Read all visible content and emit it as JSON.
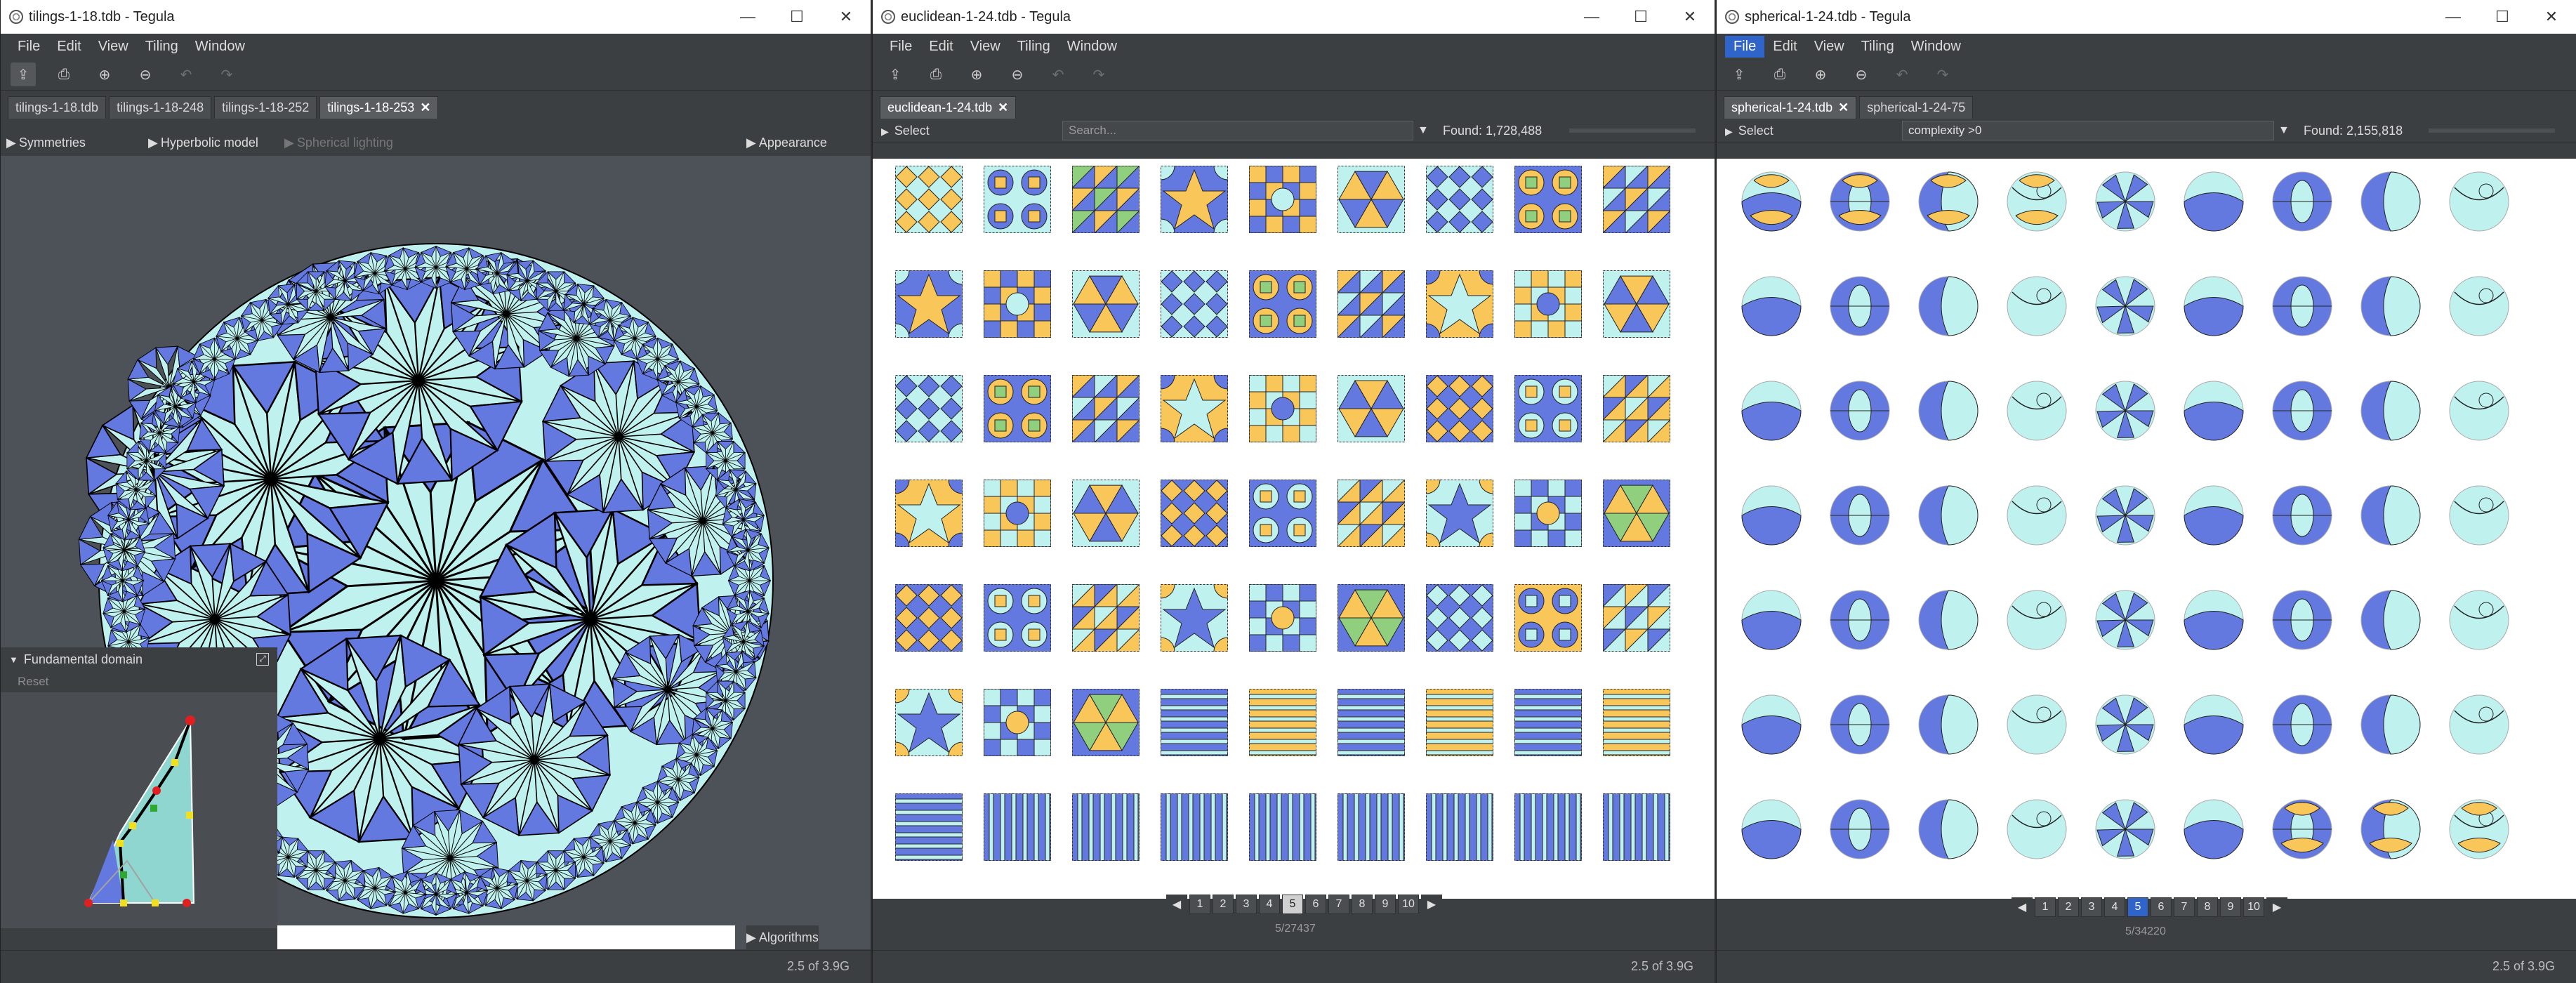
{
  "windows": [
    {
      "title": "tilings-1-18.tdb - Tegula",
      "menu": [
        "File",
        "Edit",
        "View",
        "Tiling",
        "Window"
      ],
      "tabs": [
        "tilings-1-18.tdb",
        "tilings-1-18-248",
        "tilings-1-18-252",
        "tilings-1-18-253"
      ],
      "selected_tab": 3,
      "panels": {
        "symmetries": "Symmetries",
        "hyperbolic": "Hyperbolic model",
        "spherical": "Spherical lighting",
        "appearance": "Appearance",
        "fundamental": "Fundamental domain",
        "reset": "Reset",
        "algorithms": "Algorithms"
      },
      "memory": "2.5 of 3.9G"
    },
    {
      "title": "euclidean-1-24.tdb - Tegula",
      "menu": [
        "File",
        "Edit",
        "View",
        "Tiling",
        "Window"
      ],
      "tabs": [
        "euclidean-1-24.tdb"
      ],
      "select_label": "Select",
      "search_placeholder": "Search...",
      "found": "Found: 1,728,488",
      "pages": [
        "1",
        "2",
        "3",
        "4",
        "5",
        "6",
        "7",
        "8",
        "9",
        "10"
      ],
      "current_page": 4,
      "page_count": "5/27437",
      "memory": "2.5 of 3.9G"
    },
    {
      "title": "spherical-1-24.tdb - Tegula",
      "menu": [
        "File",
        "Edit",
        "View",
        "Tiling",
        "Window"
      ],
      "active_menu": 0,
      "tabs": [
        "spherical-1-24.tdb",
        "spherical-1-24-75"
      ],
      "select_label": "Select",
      "search_value": "complexity >0",
      "found": "Found: 2,155,818",
      "pages": [
        "1",
        "2",
        "3",
        "4",
        "5",
        "6",
        "7",
        "8",
        "9",
        "10"
      ],
      "current_page": 4,
      "page_count": "5/34220",
      "memory": "2.5 of 3.9G"
    }
  ],
  "window_controls": [
    "—",
    "☐",
    "✕"
  ],
  "colors": {
    "tile_light": "#bff1ef",
    "tile_blue": "#6479e0",
    "tile_orange": "#f9c65a",
    "tile_green": "#8fcf7d",
    "accent": "#2f65ca"
  }
}
